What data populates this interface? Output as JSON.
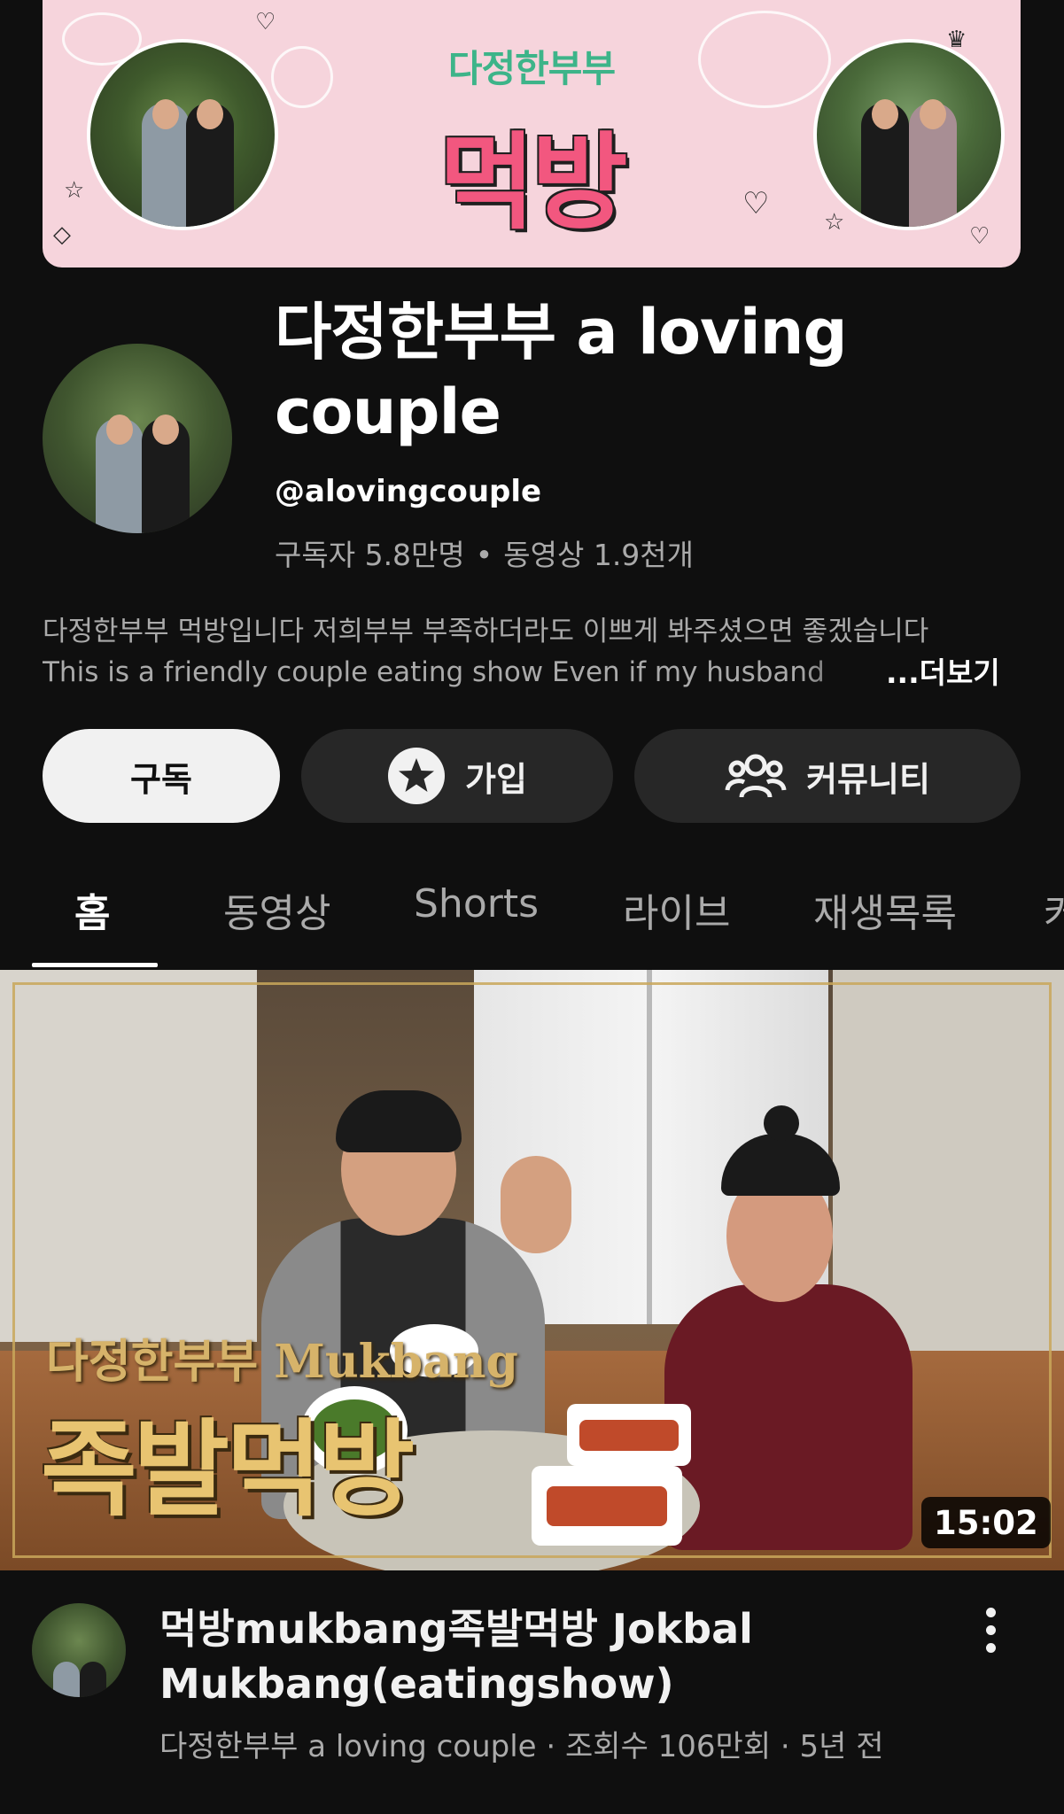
{
  "banner": {
    "subtitle": "다정한부부",
    "title": "먹방"
  },
  "channel": {
    "name": "다정한부부 a loving couple",
    "handle": "@alovingcouple",
    "subscribers": "구독자 5.8만명",
    "videos": "동영상 1.9천개",
    "separator": "•",
    "description_line1": "다정한부부 먹방입니다 저희부부 부족하더라도 이쁘게 봐주셨으면 좋겠습니다",
    "description_line2": "This is a friendly couple eating show Even if my husband",
    "more": "...더보기"
  },
  "actions": {
    "subscribe": "구독",
    "join": "가입",
    "community": "커뮤니티"
  },
  "tabs": [
    {
      "label": "홈",
      "active": true
    },
    {
      "label": "동영상"
    },
    {
      "label": "Shorts"
    },
    {
      "label": "라이브"
    },
    {
      "label": "재생목록"
    },
    {
      "label": "커"
    }
  ],
  "video": {
    "thumbnail_subtitle": "다정한부부 Mukbang",
    "thumbnail_title": "족발먹방",
    "duration": "15:02",
    "title": "먹방mukbang족발먹방 Jokbal Mukbang(eatingshow)",
    "meta": "다정한부부 a loving couple · 조회수 106만회 · 5년 전"
  },
  "icons": {
    "join": "star-circle-icon",
    "community": "people-icon",
    "menu": "more-vert-icon"
  },
  "colors": {
    "background": "#0f0f0f",
    "banner_pink": "#f6d4dc",
    "banner_title": "#f2577f",
    "banner_subtitle": "#3db489",
    "thumbnail_gold": "#e8c471"
  }
}
